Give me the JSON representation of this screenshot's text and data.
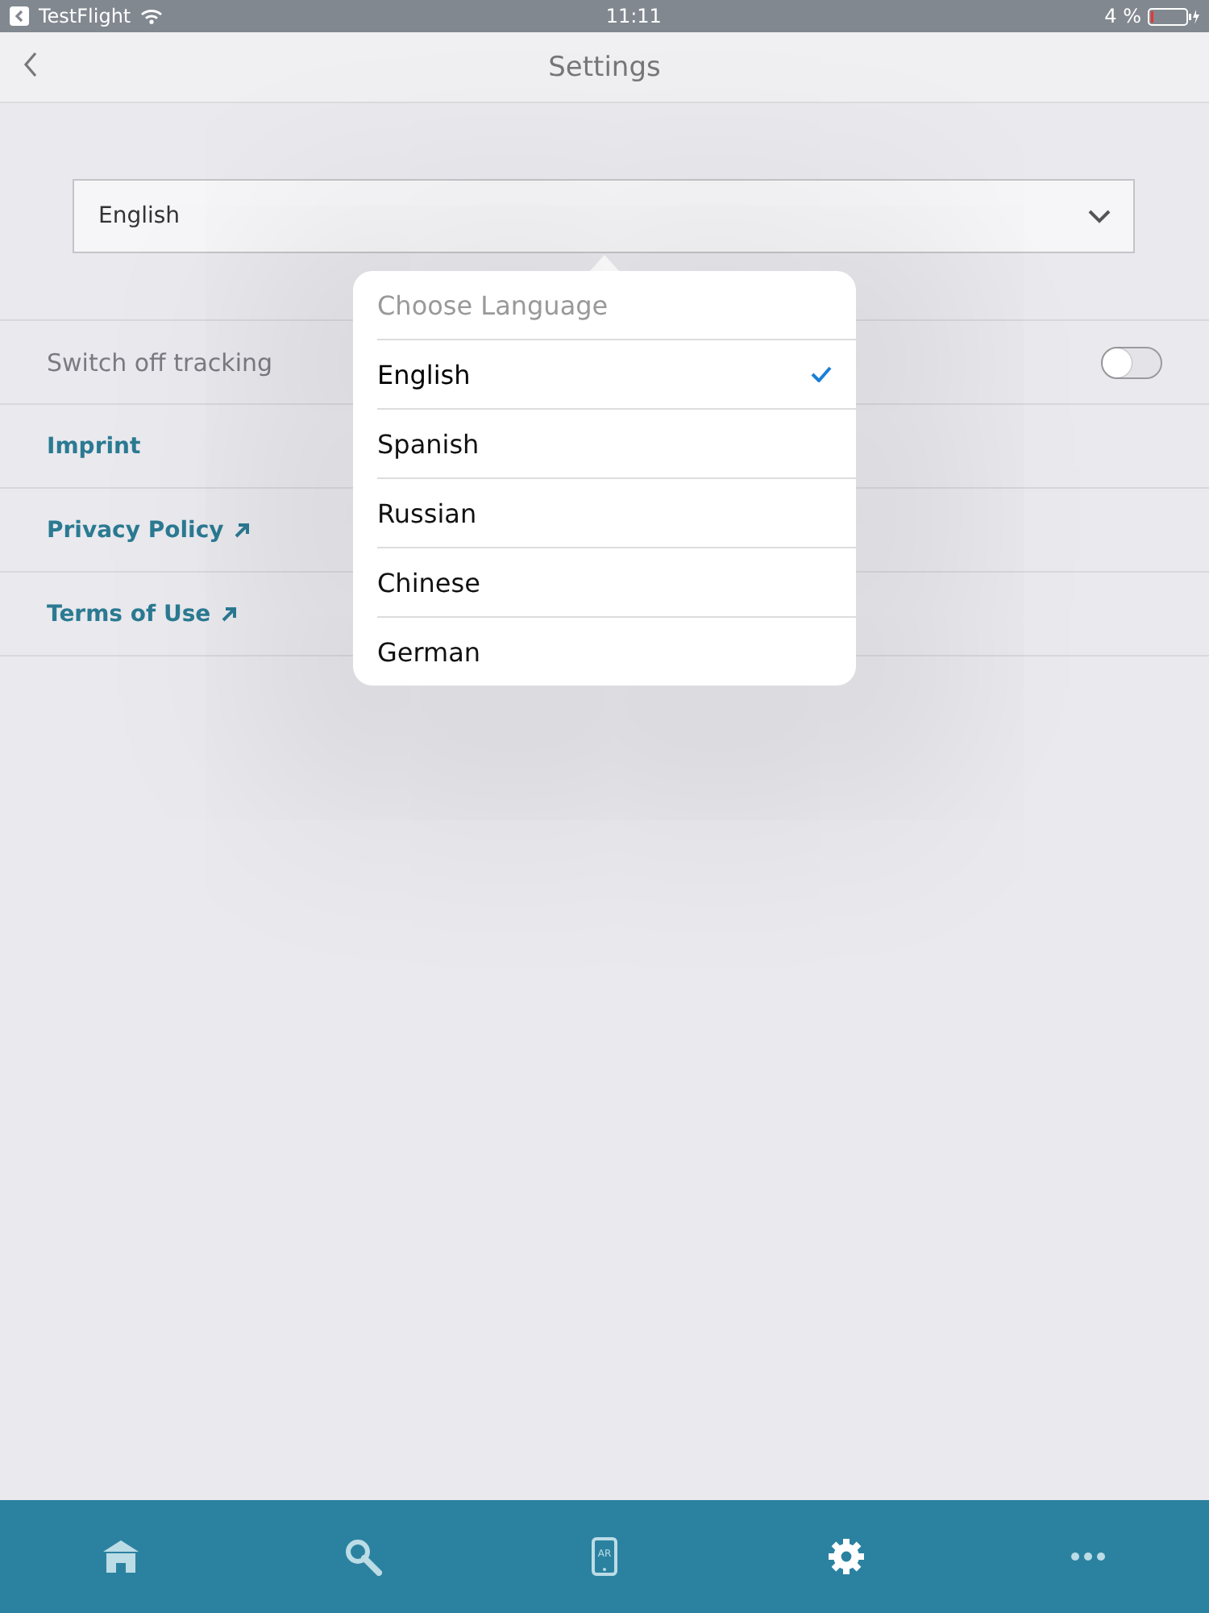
{
  "status_bar": {
    "back_app": "TestFlight",
    "time": "11:11",
    "battery": "4 %"
  },
  "nav": {
    "title": "Settings"
  },
  "language_select": {
    "value": "English"
  },
  "rows": [
    {
      "kind": "toggle",
      "label": "Switch off tracking",
      "on": false
    },
    {
      "kind": "link",
      "label": "Imprint",
      "external": false
    },
    {
      "kind": "link",
      "label": "Privacy Policy",
      "external": true
    },
    {
      "kind": "link",
      "label": "Terms of Use",
      "external": true
    }
  ],
  "popover": {
    "title": "Choose Language",
    "options": [
      {
        "label": "English",
        "selected": true
      },
      {
        "label": "Spanish",
        "selected": false
      },
      {
        "label": "Russian",
        "selected": false
      },
      {
        "label": "Chinese",
        "selected": false
      },
      {
        "label": "German",
        "selected": false
      }
    ]
  },
  "tab_bar": [
    {
      "kind": "home",
      "selected": false
    },
    {
      "kind": "search",
      "selected": false
    },
    {
      "kind": "ar",
      "icon_text": "AR",
      "selected": false
    },
    {
      "kind": "settings",
      "selected": true
    },
    {
      "kind": "more",
      "selected": false
    }
  ]
}
